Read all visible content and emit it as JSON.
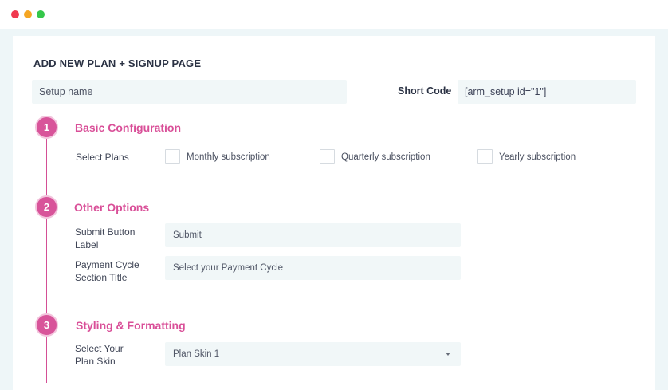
{
  "page": {
    "title": "ADD NEW PLAN + SIGNUP PAGE"
  },
  "setup": {
    "name_placeholder": "Setup name",
    "shortcode_label": "Short Code",
    "shortcode_value": "[arm_setup id=\"1\"]"
  },
  "steps": [
    {
      "number": "1",
      "title": "Basic Configuration",
      "select_plans_label": "Select Plans",
      "plans": [
        {
          "label": "Monthly subscription",
          "checked": false
        },
        {
          "label": "Quarterly subscription",
          "checked": false
        },
        {
          "label": "Yearly subscription",
          "checked": false
        }
      ]
    },
    {
      "number": "2",
      "title": "Other Options",
      "submit_label_line1": "Submit Button",
      "submit_label_line2": "Label",
      "submit_value": "Submit",
      "payment_label_line1": "Payment Cycle",
      "payment_label_line2": "Section Title",
      "payment_placeholder": "Select your Payment Cycle"
    },
    {
      "number": "3",
      "title": "Styling & Formatting",
      "skin_label_line1": "Select Your",
      "skin_label_line2": "Plan Skin",
      "skin_selected": "Plan Skin 1"
    }
  ],
  "colors": {
    "accent": "#d8549a",
    "field_bg": "#f1f7f8",
    "window_bg": "#eef6f8"
  },
  "icons": {
    "close_dot": "red-circle",
    "minimize_dot": "yellow-circle",
    "maximize_dot": "green-circle",
    "select_caret": "caret-down-icon"
  }
}
